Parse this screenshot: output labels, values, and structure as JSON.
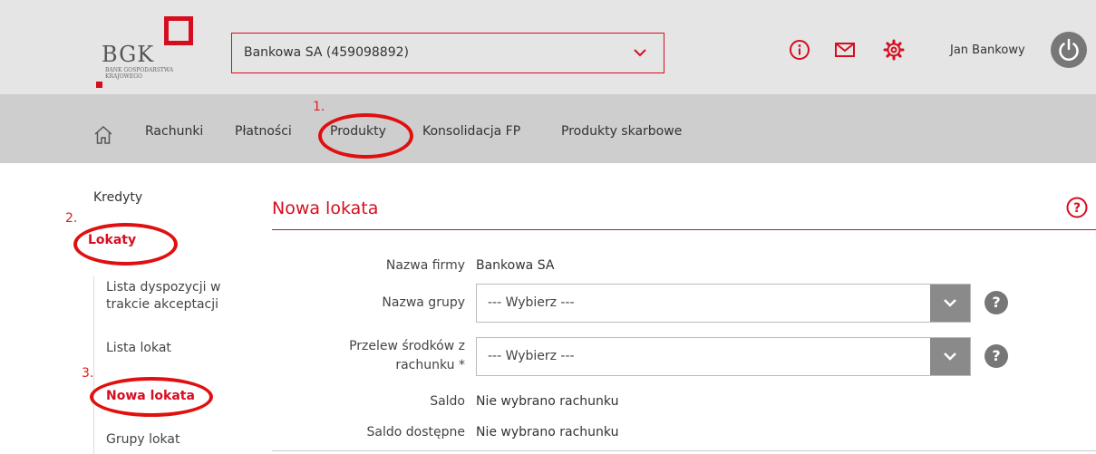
{
  "header": {
    "logo_text": "BGK",
    "logo_subtitle": "BANK GOSPODARSTWA KRAJOWEGO",
    "company_select_value": "Bankowa SA (459098892)",
    "user_name": "Jan Bankowy"
  },
  "nav": {
    "items": [
      "Rachunki",
      "Płatności",
      "Produkty",
      "Konsolidacja FP",
      "Produkty skarbowe"
    ]
  },
  "annotations": [
    "1.",
    "2.",
    "3."
  ],
  "sidebar": {
    "kredyty": "Kredyty",
    "lokaty": "Lokaty",
    "lista_dyspozycji_l1": "Lista dyspozycji w",
    "lista_dyspozycji_l2": "trakcie akceptacji",
    "lista_lokat": "Lista lokat",
    "nowa_lokata": "Nowa lokata",
    "grupy_lokat": "Grupy lokat"
  },
  "main": {
    "title": "Nowa lokata",
    "fields": {
      "nazwa_firmy_label": "Nazwa firmy",
      "nazwa_firmy_value": "Bankowa SA",
      "nazwa_grupy_label": "Nazwa grupy",
      "nazwa_grupy_placeholder": "--- Wybierz ---",
      "przelew_label_l1": "Przelew środków z",
      "przelew_label_l2": "rachunku *",
      "przelew_placeholder": "--- Wybierz ---",
      "saldo_label": "Saldo",
      "saldo_value": "Nie wybrano rachunku",
      "saldo_dostepne_label": "Saldo dostępne",
      "saldo_dostepne_value": "Nie wybrano rachunku"
    }
  },
  "colors": {
    "brand_red": "#d60d1f",
    "annotation_red": "#e01010",
    "header_bg": "#e5e5e5",
    "nav_bg": "#cecece"
  }
}
